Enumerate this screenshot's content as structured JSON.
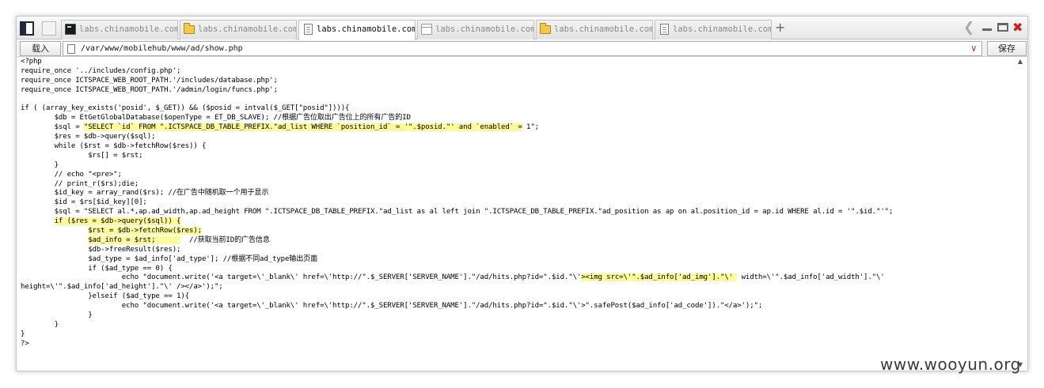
{
  "tabs": [
    {
      "label": "labs.chinamobile.com",
      "icon": "terminal-icon",
      "active": false
    },
    {
      "label": "labs.chinamobile.com",
      "icon": "folder-icon",
      "active": false
    },
    {
      "label": "labs.chinamobile.com",
      "icon": "document-icon",
      "active": true
    },
    {
      "label": "labs.chinamobile.com",
      "icon": "window-icon",
      "active": false
    },
    {
      "label": "labs.chinamobile.com",
      "icon": "folder-icon",
      "active": false
    },
    {
      "label": "labs.chinamobile.com",
      "icon": "document-icon",
      "active": false
    }
  ],
  "toolbar": {
    "new_tab": "+",
    "load_label": "载入",
    "save_label": "保存",
    "path": "/var/www/mobilehub/www/ad/show.php"
  },
  "colors": {
    "highlight": "#fffb9c",
    "close": "#d21d1d"
  },
  "code": [
    {
      "text": "<?php",
      "hl": []
    },
    {
      "text": "require_once '../includes/config.php';",
      "hl": []
    },
    {
      "text": "require_once ICTSPACE_WEB_ROOT_PATH.'/includes/database.php';",
      "hl": []
    },
    {
      "text": "require_once ICTSPACE_WEB_ROOT_PATH.'/admin/login/funcs.php';",
      "hl": []
    },
    {
      "text": "",
      "hl": []
    },
    {
      "text": "if ( (array_key_exists('posid', $_GET)) && ($posid = intval($_GET[\"posid\"]))){",
      "hl": []
    },
    {
      "text": "        $db = EtGetGlobalDatabase($openType = ET_DB_SLAVE); //根据广告位取出广告位上的所有广告的ID",
      "hl": []
    },
    {
      "text": "        $sql = \"SELECT `id` FROM \".ICTSPACE_DB_TABLE_PREFIX.\"ad_list WHERE `position_id` = '\".$posid.\"' and `enabled` = 1\";",
      "hl": [
        [
          15,
          119
        ]
      ]
    },
    {
      "text": "        $res = $db->query($sql);",
      "hl": []
    },
    {
      "text": "        while ($rst = $db->fetchRow($res)) {",
      "hl": []
    },
    {
      "text": "                $rs[] = $rst;",
      "hl": []
    },
    {
      "text": "        }",
      "hl": []
    },
    {
      "text": "        // echo \"<pre>\";",
      "hl": []
    },
    {
      "text": "        // print_r($rs);die;",
      "hl": []
    },
    {
      "text": "        $id_key = array_rand($rs); //在广告中随机取一个用于显示",
      "hl": []
    },
    {
      "text": "        $id = $rs[$id_key][0];",
      "hl": []
    },
    {
      "text": "        $sql = \"SELECT al.*,ap.ad_width,ap.ad_height FROM \".ICTSPACE_DB_TABLE_PREFIX.\"ad_list as al left join \".ICTSPACE_DB_TABLE_PREFIX.\"ad_position as ap on al.position_id = ap.id WHERE al.id = '\".$id.\"'\";",
      "hl": []
    },
    {
      "text": "        if ($res = $db->query($sql)) {",
      "hl": [
        [
          8,
          38
        ]
      ]
    },
    {
      "text": "                $rst = $db->fetchRow($res);",
      "hl": [
        [
          16,
          43
        ]
      ]
    },
    {
      "text": "                $ad_info = $rst;        //获取当前ID的广告信息",
      "hl": [
        [
          16,
          38
        ]
      ]
    },
    {
      "text": "                $db->freeResult($res);",
      "hl": []
    },
    {
      "text": "                $ad_type = $ad_info['ad_type']; //根据不同ad_type输出页面",
      "hl": []
    },
    {
      "text": "                if ($ad_type == 0) {",
      "hl": []
    },
    {
      "text": "                        echo \"document.write('<a target=\\'_blank\\' href=\\'http://\".$_SERVER['SERVER_NAME'].\"/ad/hits.php?id=\".$id.\"\\'><img src=\\'\".$ad_info['ad_img'].\"\\'  width=\\'\".$ad_info['ad_width'].\"\\'",
      "hl": [
        [
          133,
          170
        ]
      ]
    },
    {
      "text": "height=\\'\".$ad_info['ad_height'].\"\\' /></a>');\";",
      "hl": []
    },
    {
      "text": "                }elseif ($ad_type == 1){",
      "hl": []
    },
    {
      "text": "                        echo \"document.write('<a target=\\'_blank\\' href=\\'http://\".$_SERVER['SERVER_NAME'].\"/ad/hits.php?id=\".$id.\"\\'>\".safePost($ad_info['ad_code']).\"</a>');\";",
      "hl": []
    },
    {
      "text": "                }",
      "hl": []
    },
    {
      "text": "        }",
      "hl": []
    },
    {
      "text": "}",
      "hl": []
    },
    {
      "text": "?>",
      "hl": []
    }
  ],
  "watermark": "www.wooyun.org"
}
